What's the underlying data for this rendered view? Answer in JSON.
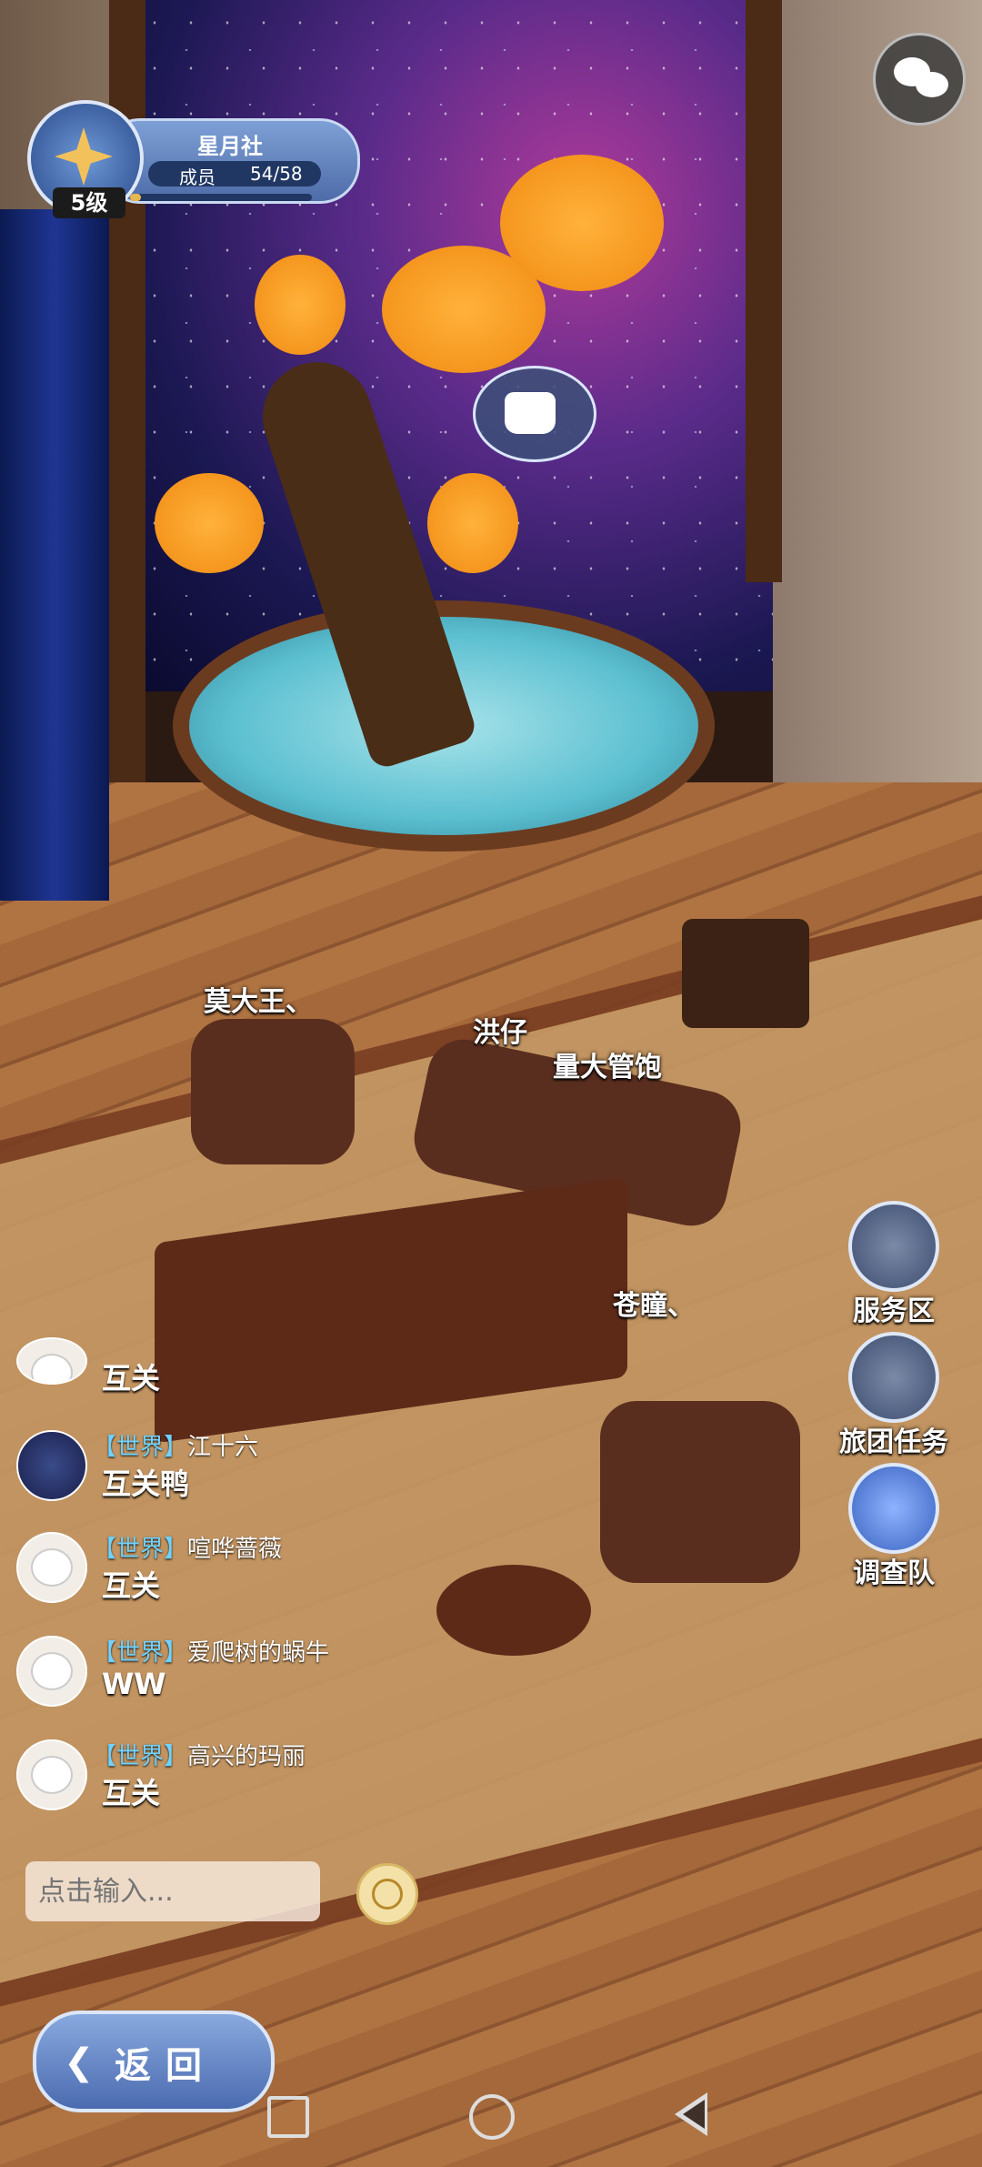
{
  "guild": {
    "name": "星月社",
    "members_label": "成员",
    "members_count": "54/58",
    "level": "5级",
    "level_progress": 0.06
  },
  "top": {
    "chat_icon": "chat-bubbles-icon"
  },
  "scene": {
    "watering_icon": "watering-can-icon",
    "players": [
      "莫大王、",
      "洪仔",
      "量大管饱",
      "苍瞳、"
    ]
  },
  "side_buttons": [
    {
      "label": "服务区",
      "icon": "shop-icon"
    },
    {
      "label": "旅团任务",
      "icon": "quest-book-icon"
    },
    {
      "label": "调查队",
      "icon": "winged-sword-icon"
    }
  ],
  "chat": {
    "messages": [
      {
        "channel": "",
        "sender": "",
        "text": "互关"
      },
      {
        "channel": "【世界】",
        "sender": "江十六",
        "text": "互关鸭"
      },
      {
        "channel": "【世界】",
        "sender": "喧哗蔷薇",
        "text": "互关"
      },
      {
        "channel": "【世界】",
        "sender": "爱爬树的蜗牛",
        "text": "WW"
      },
      {
        "channel": "【世界】",
        "sender": "高兴的玛丽",
        "text": "互关"
      }
    ],
    "input_placeholder": "点击输入...",
    "emoji_icon": "smiley-icon"
  },
  "back_button": {
    "label": "返回"
  },
  "colors": {
    "accent": "#6fd2ff",
    "ui_blue": "#4e6ca8",
    "gold": "#e6b94e"
  }
}
